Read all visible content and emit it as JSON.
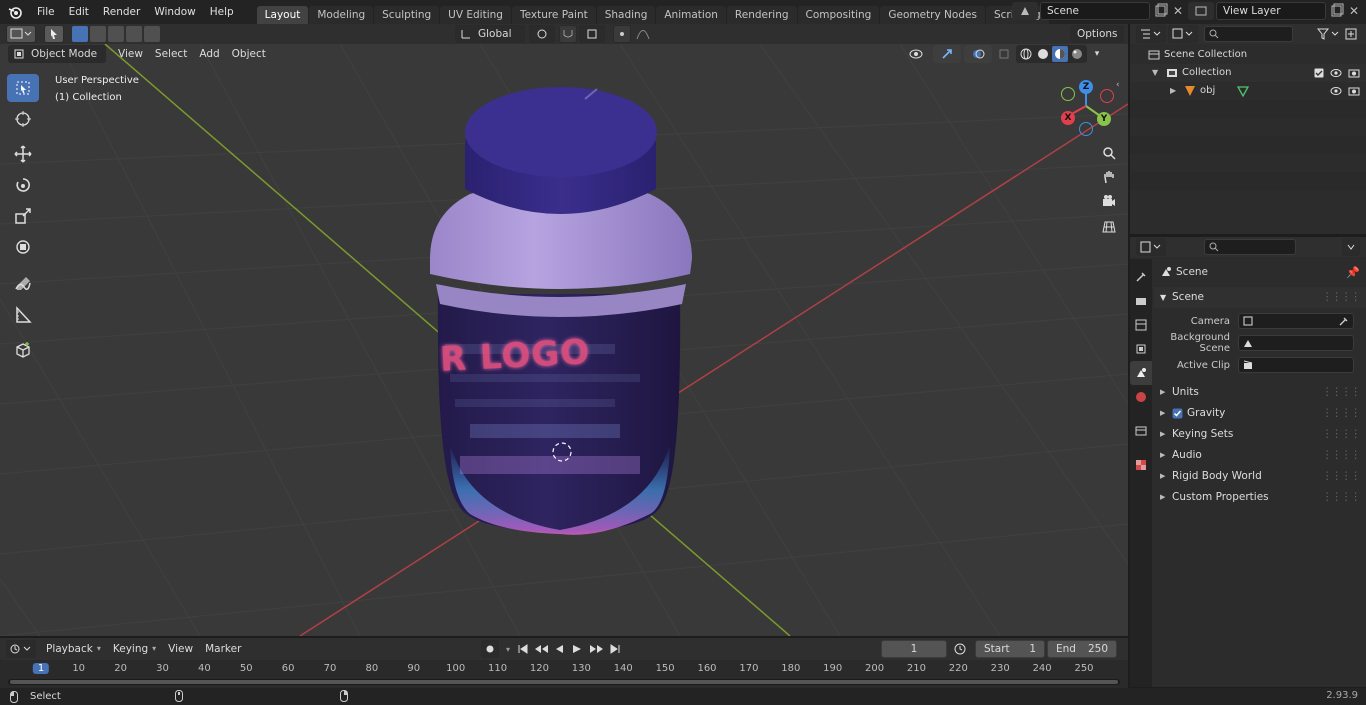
{
  "menu": [
    "File",
    "Edit",
    "Render",
    "Window",
    "Help"
  ],
  "workspaces": [
    "Layout",
    "Modeling",
    "Sculpting",
    "UV Editing",
    "Texture Paint",
    "Shading",
    "Animation",
    "Rendering",
    "Compositing",
    "Geometry Nodes",
    "Scripting"
  ],
  "active_workspace": "Layout",
  "scene_field": "Scene",
  "view_layer_field": "View Layer",
  "viewport_header": {
    "mode": "Object Mode",
    "menus": [
      "View",
      "Select",
      "Add",
      "Object"
    ],
    "transform_orientation": "Global",
    "options": "Options"
  },
  "viewport_overlay": {
    "perspective": "User Perspective",
    "collection": "(1) Collection"
  },
  "label_text": "R LOGO",
  "gizmo": {
    "z": "Z",
    "y": "Y",
    "x": "X"
  },
  "outliner": {
    "scene_collection": "Scene Collection",
    "collection": "Collection",
    "object": "obj"
  },
  "properties": {
    "breadcrumb": "Scene",
    "section": "Scene",
    "camera_label": "Camera",
    "background_scene_label": "Background Scene",
    "active_clip_label": "Active Clip",
    "panels": [
      "Units",
      "Gravity",
      "Keying Sets",
      "Audio",
      "Rigid Body World",
      "Custom Properties"
    ]
  },
  "timeline": {
    "menus": [
      "Playback",
      "Keying",
      "View",
      "Marker"
    ],
    "current_frame": "1",
    "start_label": "Start",
    "start_value": "1",
    "end_label": "End",
    "end_value": "250",
    "ticks": [
      "1",
      "10",
      "20",
      "30",
      "40",
      "50",
      "60",
      "70",
      "80",
      "90",
      "100",
      "110",
      "120",
      "130",
      "140",
      "150",
      "160",
      "170",
      "180",
      "190",
      "200",
      "210",
      "220",
      "230",
      "240",
      "250"
    ]
  },
  "status": {
    "left": "Select",
    "version": "2.93.9"
  },
  "colors": {
    "accent": "#4772b3",
    "x_axis": "#e0404d",
    "y_axis": "#8bc34a",
    "z_axis": "#3d8fe8"
  }
}
